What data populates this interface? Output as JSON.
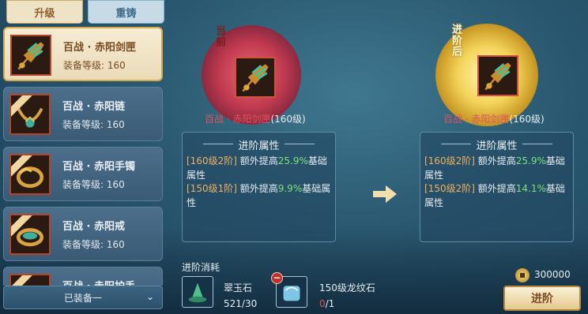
{
  "tabs": [
    {
      "label": "升级"
    },
    {
      "label": "重铸"
    }
  ],
  "equipment_list": [
    {
      "name": "百战 · 赤阳剑匣",
      "level": "装备等级: 160",
      "selected": true
    },
    {
      "name": "百战 · 赤阳链",
      "level": "装备等级: 160",
      "selected": false
    },
    {
      "name": "百战 · 赤阳手镯",
      "level": "装备等级: 160",
      "selected": false
    },
    {
      "name": "百战 · 赤阳戒",
      "level": "装备等级: 160",
      "selected": false
    },
    {
      "name": "百战 · 赤阳护手",
      "level": "",
      "selected": false
    }
  ],
  "equip_filter": "已装备一",
  "current": {
    "badge": "当前",
    "name_red": "百战 · 赤阳剑匣",
    "name_level": "(160级)"
  },
  "next": {
    "badge": "进阶后",
    "name_red": "百战 · 赤阳剑匣",
    "name_level": "(160级)"
  },
  "attr_panel_title": "进阶属性",
  "current_attrs": [
    {
      "tag": "[160级2阶]",
      "prefix": " 额外提高",
      "pct": "25.9%",
      "suffix": "基础属性"
    },
    {
      "tag": "[150级1阶]",
      "prefix": " 额外提高",
      "pct": "9.9%",
      "suffix": "基础属性"
    }
  ],
  "next_attrs": [
    {
      "tag": "[160级2阶]",
      "prefix": " 额外提高",
      "pct": "25.9%",
      "suffix": "基础属性"
    },
    {
      "tag": "[150级2阶]",
      "prefix": " 额外提高",
      "pct": "14.1%",
      "suffix": "基础属性"
    }
  ],
  "cost": {
    "label": "进阶消耗",
    "materials": [
      {
        "name": "翠玉石",
        "count": "521/30",
        "count_color": "#e6ecf0"
      },
      {
        "name": "150级龙纹石",
        "count_have": "0",
        "count_need": "/1"
      }
    ],
    "gold": "300000"
  },
  "advance_button": "进阶",
  "colors": {
    "red_name": "#e0525c",
    "green_pct": "#7fe07a",
    "tag_orange": "#f0b060",
    "insufficient": "#e0525c"
  },
  "icons": [
    "sword-case-icon",
    "necklace-icon",
    "bracelet-icon",
    "ring-icon",
    "gauntlet-icon",
    "arrow-right-icon",
    "jade-stone-icon",
    "dragon-stone-icon",
    "coin-icon",
    "chevron-down-icon",
    "minus-icon"
  ]
}
